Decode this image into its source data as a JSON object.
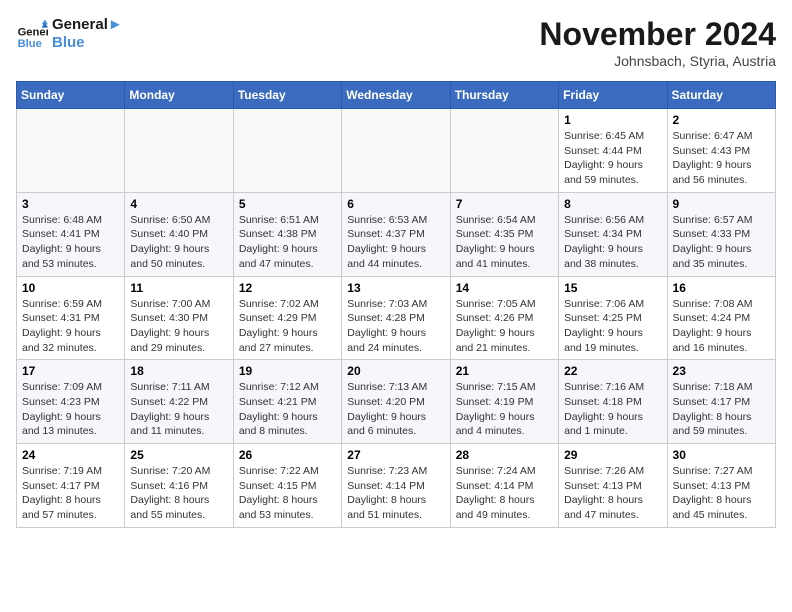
{
  "logo": {
    "line1": "General",
    "line2": "Blue"
  },
  "title": "November 2024",
  "subtitle": "Johnsbach, Styria, Austria",
  "days_of_week": [
    "Sunday",
    "Monday",
    "Tuesday",
    "Wednesday",
    "Thursday",
    "Friday",
    "Saturday"
  ],
  "weeks": [
    [
      {
        "num": "",
        "info": ""
      },
      {
        "num": "",
        "info": ""
      },
      {
        "num": "",
        "info": ""
      },
      {
        "num": "",
        "info": ""
      },
      {
        "num": "",
        "info": ""
      },
      {
        "num": "1",
        "info": "Sunrise: 6:45 AM\nSunset: 4:44 PM\nDaylight: 9 hours and 59 minutes."
      },
      {
        "num": "2",
        "info": "Sunrise: 6:47 AM\nSunset: 4:43 PM\nDaylight: 9 hours and 56 minutes."
      }
    ],
    [
      {
        "num": "3",
        "info": "Sunrise: 6:48 AM\nSunset: 4:41 PM\nDaylight: 9 hours and 53 minutes."
      },
      {
        "num": "4",
        "info": "Sunrise: 6:50 AM\nSunset: 4:40 PM\nDaylight: 9 hours and 50 minutes."
      },
      {
        "num": "5",
        "info": "Sunrise: 6:51 AM\nSunset: 4:38 PM\nDaylight: 9 hours and 47 minutes."
      },
      {
        "num": "6",
        "info": "Sunrise: 6:53 AM\nSunset: 4:37 PM\nDaylight: 9 hours and 44 minutes."
      },
      {
        "num": "7",
        "info": "Sunrise: 6:54 AM\nSunset: 4:35 PM\nDaylight: 9 hours and 41 minutes."
      },
      {
        "num": "8",
        "info": "Sunrise: 6:56 AM\nSunset: 4:34 PM\nDaylight: 9 hours and 38 minutes."
      },
      {
        "num": "9",
        "info": "Sunrise: 6:57 AM\nSunset: 4:33 PM\nDaylight: 9 hours and 35 minutes."
      }
    ],
    [
      {
        "num": "10",
        "info": "Sunrise: 6:59 AM\nSunset: 4:31 PM\nDaylight: 9 hours and 32 minutes."
      },
      {
        "num": "11",
        "info": "Sunrise: 7:00 AM\nSunset: 4:30 PM\nDaylight: 9 hours and 29 minutes."
      },
      {
        "num": "12",
        "info": "Sunrise: 7:02 AM\nSunset: 4:29 PM\nDaylight: 9 hours and 27 minutes."
      },
      {
        "num": "13",
        "info": "Sunrise: 7:03 AM\nSunset: 4:28 PM\nDaylight: 9 hours and 24 minutes."
      },
      {
        "num": "14",
        "info": "Sunrise: 7:05 AM\nSunset: 4:26 PM\nDaylight: 9 hours and 21 minutes."
      },
      {
        "num": "15",
        "info": "Sunrise: 7:06 AM\nSunset: 4:25 PM\nDaylight: 9 hours and 19 minutes."
      },
      {
        "num": "16",
        "info": "Sunrise: 7:08 AM\nSunset: 4:24 PM\nDaylight: 9 hours and 16 minutes."
      }
    ],
    [
      {
        "num": "17",
        "info": "Sunrise: 7:09 AM\nSunset: 4:23 PM\nDaylight: 9 hours and 13 minutes."
      },
      {
        "num": "18",
        "info": "Sunrise: 7:11 AM\nSunset: 4:22 PM\nDaylight: 9 hours and 11 minutes."
      },
      {
        "num": "19",
        "info": "Sunrise: 7:12 AM\nSunset: 4:21 PM\nDaylight: 9 hours and 8 minutes."
      },
      {
        "num": "20",
        "info": "Sunrise: 7:13 AM\nSunset: 4:20 PM\nDaylight: 9 hours and 6 minutes."
      },
      {
        "num": "21",
        "info": "Sunrise: 7:15 AM\nSunset: 4:19 PM\nDaylight: 9 hours and 4 minutes."
      },
      {
        "num": "22",
        "info": "Sunrise: 7:16 AM\nSunset: 4:18 PM\nDaylight: 9 hours and 1 minute."
      },
      {
        "num": "23",
        "info": "Sunrise: 7:18 AM\nSunset: 4:17 PM\nDaylight: 8 hours and 59 minutes."
      }
    ],
    [
      {
        "num": "24",
        "info": "Sunrise: 7:19 AM\nSunset: 4:17 PM\nDaylight: 8 hours and 57 minutes."
      },
      {
        "num": "25",
        "info": "Sunrise: 7:20 AM\nSunset: 4:16 PM\nDaylight: 8 hours and 55 minutes."
      },
      {
        "num": "26",
        "info": "Sunrise: 7:22 AM\nSunset: 4:15 PM\nDaylight: 8 hours and 53 minutes."
      },
      {
        "num": "27",
        "info": "Sunrise: 7:23 AM\nSunset: 4:14 PM\nDaylight: 8 hours and 51 minutes."
      },
      {
        "num": "28",
        "info": "Sunrise: 7:24 AM\nSunset: 4:14 PM\nDaylight: 8 hours and 49 minutes."
      },
      {
        "num": "29",
        "info": "Sunrise: 7:26 AM\nSunset: 4:13 PM\nDaylight: 8 hours and 47 minutes."
      },
      {
        "num": "30",
        "info": "Sunrise: 7:27 AM\nSunset: 4:13 PM\nDaylight: 8 hours and 45 minutes."
      }
    ]
  ]
}
